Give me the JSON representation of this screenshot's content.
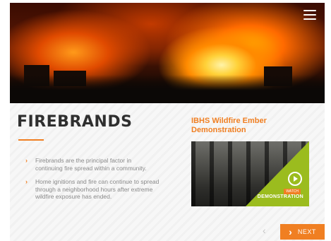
{
  "page": {
    "title": "FIREBRANDS",
    "bullets": [
      "Firebrands are the principal factor in continuing fire spread within a community.",
      "Home ignitions and fire can continue to spread through a neighborhood hours after extreme wildfire exposure has ended."
    ]
  },
  "video": {
    "title": "IBHS Wildfire Ember Demonstration",
    "badge_small": "WATCH",
    "badge_big": "DEMONSTRATION"
  },
  "nav": {
    "prev_icon": "chevron-left-icon",
    "next_label": "NEXT",
    "next_icon": "chevron-right-icon"
  },
  "header": {
    "menu_icon": "hamburger-menu-icon"
  },
  "colors": {
    "accent": "#f07f22",
    "video_overlay": "#9bbc1e",
    "title_text": "#2f2f2f",
    "body_text": "#8a8a8a"
  }
}
